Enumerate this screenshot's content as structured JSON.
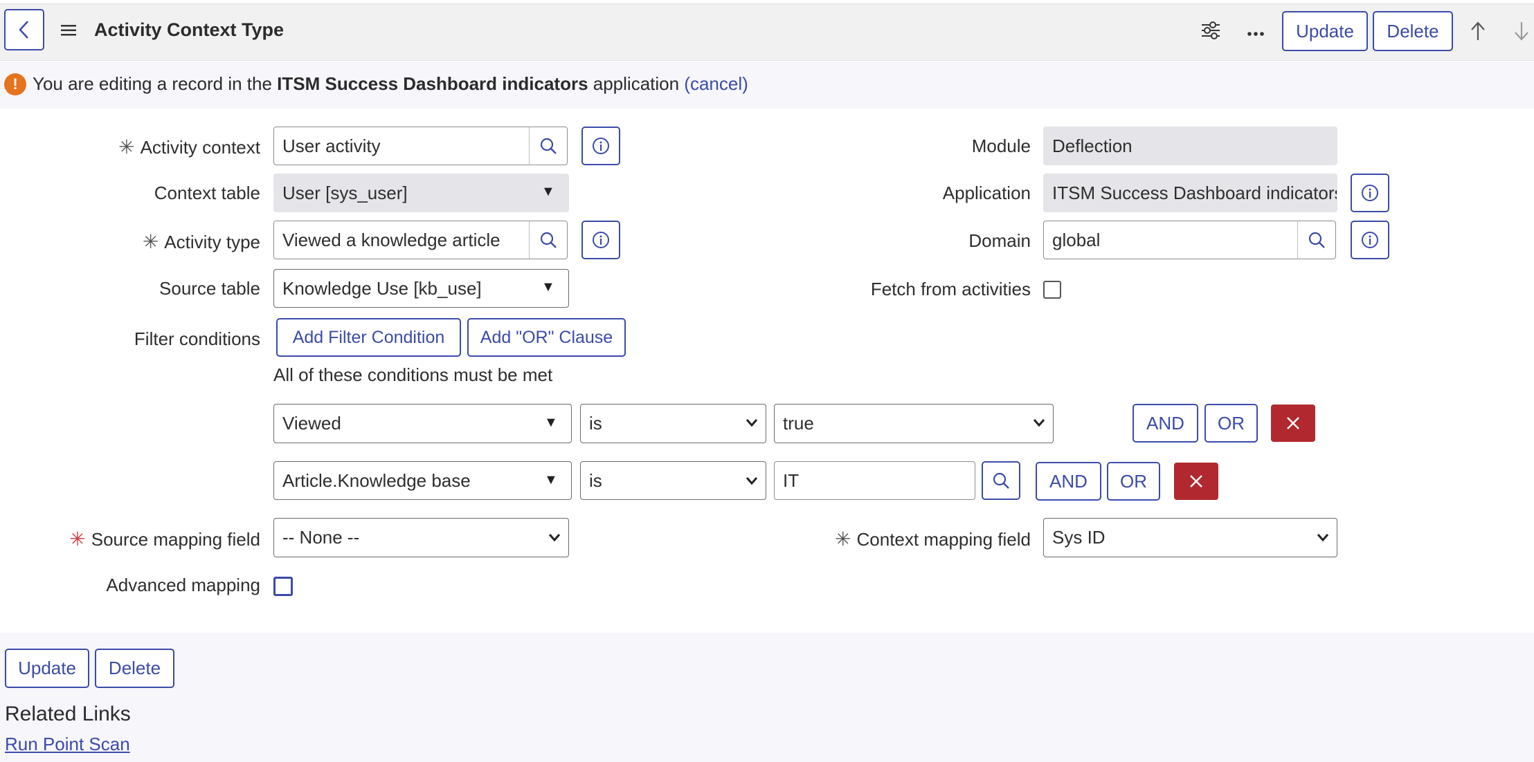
{
  "header": {
    "title": "Activity Context Type",
    "update_label": "Update",
    "delete_label": "Delete"
  },
  "banner": {
    "prefix": "You are editing a record in the ",
    "app_name": "ITSM Success Dashboard indicators",
    "suffix": " application ",
    "cancel": "(cancel)"
  },
  "form": {
    "activity_context": {
      "label": "Activity context",
      "value": "User activity"
    },
    "context_table": {
      "label": "Context table",
      "value": "User [sys_user]"
    },
    "activity_type": {
      "label": "Activity type",
      "value": "Viewed a knowledge article"
    },
    "source_table": {
      "label": "Source table",
      "value": "Knowledge Use [kb_use]"
    },
    "filter_conditions": {
      "label": "Filter conditions",
      "add_filter": "Add Filter Condition",
      "add_or": "Add \"OR\" Clause",
      "hint": "All of these conditions must be met",
      "rows": [
        {
          "field": "Viewed",
          "operator": "is",
          "value": "true"
        },
        {
          "field": "Article.Knowledge base",
          "operator": "is",
          "value": "IT"
        }
      ],
      "and_label": "AND",
      "or_label": "OR"
    },
    "source_mapping": {
      "label": "Source mapping field",
      "value": "-- None --"
    },
    "advanced_mapping": {
      "label": "Advanced mapping"
    },
    "module": {
      "label": "Module",
      "value": "Deflection"
    },
    "application": {
      "label": "Application",
      "value": "ITSM Success Dashboard indicators"
    },
    "domain": {
      "label": "Domain",
      "value": "global"
    },
    "fetch_from_activities": {
      "label": "Fetch from activities"
    },
    "context_mapping": {
      "label": "Context mapping field",
      "value": "Sys ID"
    }
  },
  "footer": {
    "update_label": "Update",
    "delete_label": "Delete",
    "related_links": "Related Links",
    "run_point_scan": "Run Point Scan"
  },
  "colors": {
    "accent": "#3b4ba8",
    "danger": "#b1282e",
    "warning": "#e6731e",
    "readonly_bg": "#e5e5e9"
  }
}
